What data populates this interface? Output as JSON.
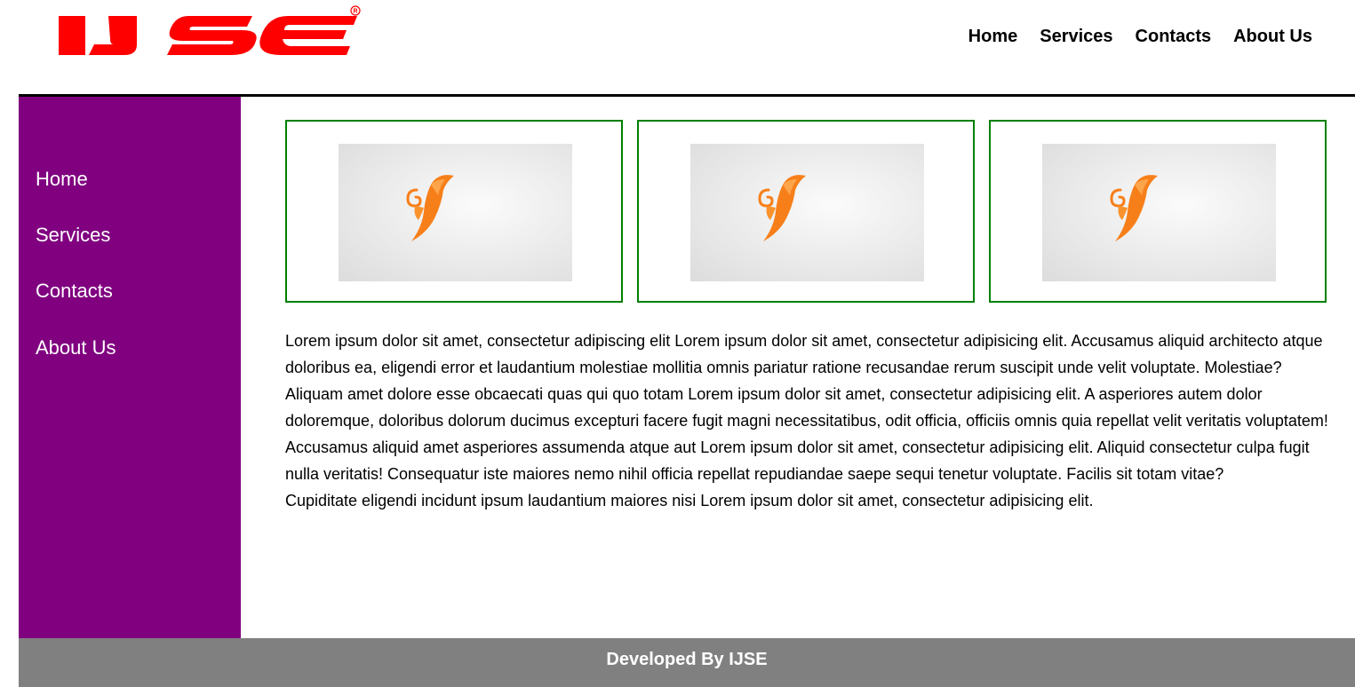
{
  "brand": {
    "logo_text": "IJSE",
    "logo_mark": "®",
    "logo_color": "#ff0000"
  },
  "top_nav": {
    "items": [
      {
        "label": "Home"
      },
      {
        "label": "Services"
      },
      {
        "label": "Contacts"
      },
      {
        "label": "About Us"
      }
    ]
  },
  "sidebar": {
    "background": "#800080",
    "items": [
      {
        "label": "Home"
      },
      {
        "label": "Services"
      },
      {
        "label": "Contacts"
      },
      {
        "label": "About Us"
      }
    ]
  },
  "cards": {
    "border_color": "#008000",
    "items": [
      {
        "icon": "leaf-logo-icon"
      },
      {
        "icon": "leaf-logo-icon"
      },
      {
        "icon": "leaf-logo-icon"
      }
    ]
  },
  "content": {
    "paragraphs": [
      "Lorem ipsum dolor sit amet, consectetur adipiscing elit Lorem ipsum dolor sit amet, consectetur adipisicing elit. Accusamus aliquid architecto atque doloribus ea, eligendi error et laudantium molestiae mollitia omnis pariatur ratione recusandae rerum suscipit unde velit voluptate. Molestiae?",
      "Aliquam amet dolore esse obcaecati quas qui quo totam Lorem ipsum dolor sit amet, consectetur adipisicing elit. A asperiores autem dolor doloremque, doloribus dolorum ducimus excepturi facere fugit magni necessitatibus, odit officia, officiis omnis quia repellat velit veritatis voluptatem!",
      "Accusamus aliquid amet asperiores assumenda atque aut Lorem ipsum dolor sit amet, consectetur adipisicing elit. Aliquid consectetur culpa fugit nulla veritatis! Consequatur iste maiores nemo nihil officia repellat repudiandae saepe sequi tenetur voluptate. Facilis sit totam vitae?",
      "Cupiditate eligendi incidunt ipsum laudantium maiores nisi Lorem ipsum dolor sit amet, consectetur adipisicing elit."
    ]
  },
  "footer": {
    "text": "Developed By IJSE",
    "background": "#808080"
  }
}
